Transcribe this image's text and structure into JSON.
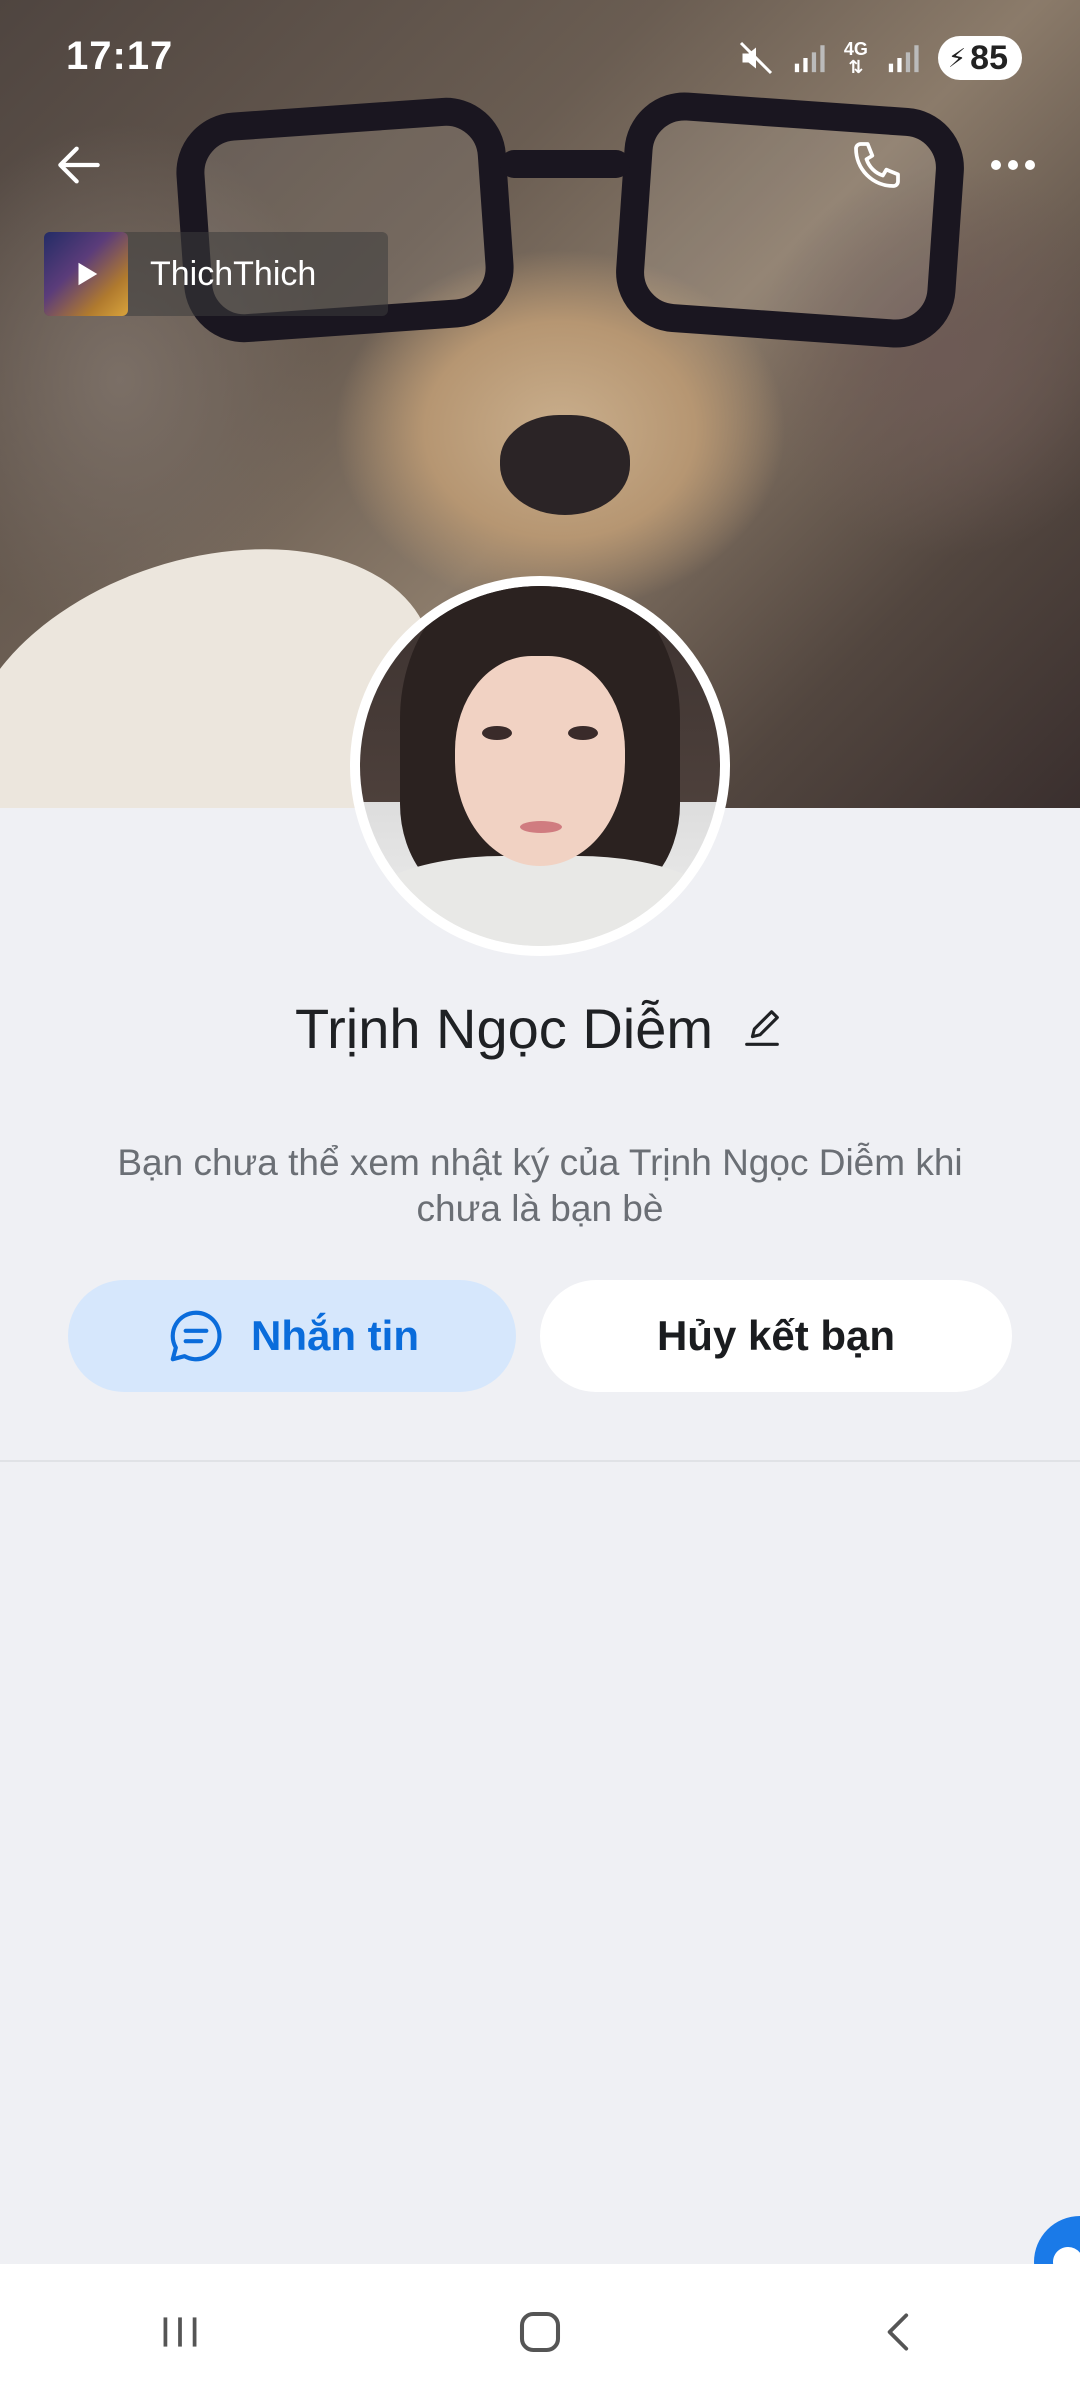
{
  "status_bar": {
    "time": "17:17",
    "network": "4G",
    "battery": "85",
    "icons": [
      "mute-icon",
      "signal-icon",
      "4g-icon",
      "signal-icon",
      "battery-charging-icon"
    ]
  },
  "nav": {
    "back_icon": "arrow-left-icon",
    "call_icon": "phone-icon",
    "more_icon": "more-horizontal-icon"
  },
  "music": {
    "title": "ThichThich",
    "icon": "play-icon"
  },
  "profile": {
    "name": "Trịnh Ngọc Diễm",
    "edit_icon": "pencil-icon",
    "privacy_note": "Bạn chưa thể xem nhật ký của Trịnh Ngọc Diễm khi chưa là bạn bè"
  },
  "actions": {
    "message_label": "Nhắn tin",
    "message_icon": "chat-bubble-icon",
    "unfriend_label": "Hủy kết bạn"
  },
  "colors": {
    "accent": "#0a6cdb",
    "message_button_bg": "#d6e7fc",
    "page_bg": "#eff0f4"
  },
  "system_nav": {
    "recents_icon": "recents-icon",
    "home_icon": "home-icon",
    "back_icon": "back-chevron-icon"
  }
}
